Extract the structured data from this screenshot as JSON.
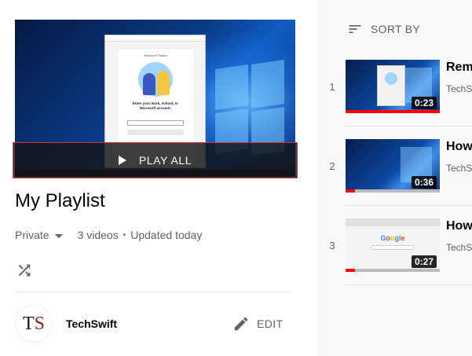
{
  "playlist": {
    "play_all_label": "PLAY ALL",
    "title": "My Playlist",
    "privacy": "Private",
    "video_count": "3 videos",
    "separator": "•",
    "updated": "Updated today"
  },
  "owner": {
    "initial_1": "T",
    "initial_2": "S",
    "name": "TechSwift"
  },
  "actions": {
    "edit_label": "EDIT",
    "sort_label": "SORT BY"
  },
  "videos": [
    {
      "index": "1",
      "title": "Rem",
      "channel": "TechS",
      "duration": "0:23",
      "progress": 1.0
    },
    {
      "index": "2",
      "title": "How",
      "channel": "TechS",
      "duration": "0:36",
      "progress": 0.1
    },
    {
      "index": "3",
      "title": "How",
      "channel": "TechS",
      "duration": "0:27",
      "progress": 0.1
    }
  ],
  "thumbnail_text": {
    "dialog_brand": "Microsoft Teams",
    "dialog_prompt": "Enter your work, school, or Microsoft account.",
    "google_logo": "Google"
  },
  "colors": {
    "accent_red": "#ff0000",
    "avatar_s": "#9b1f1f",
    "text_primary": "#030303",
    "text_secondary": "#606060"
  },
  "icons": {
    "play": "play-icon",
    "dropdown": "chevron-down-icon",
    "shuffle": "shuffle-icon",
    "edit": "pencil-icon",
    "sort": "sort-icon"
  }
}
